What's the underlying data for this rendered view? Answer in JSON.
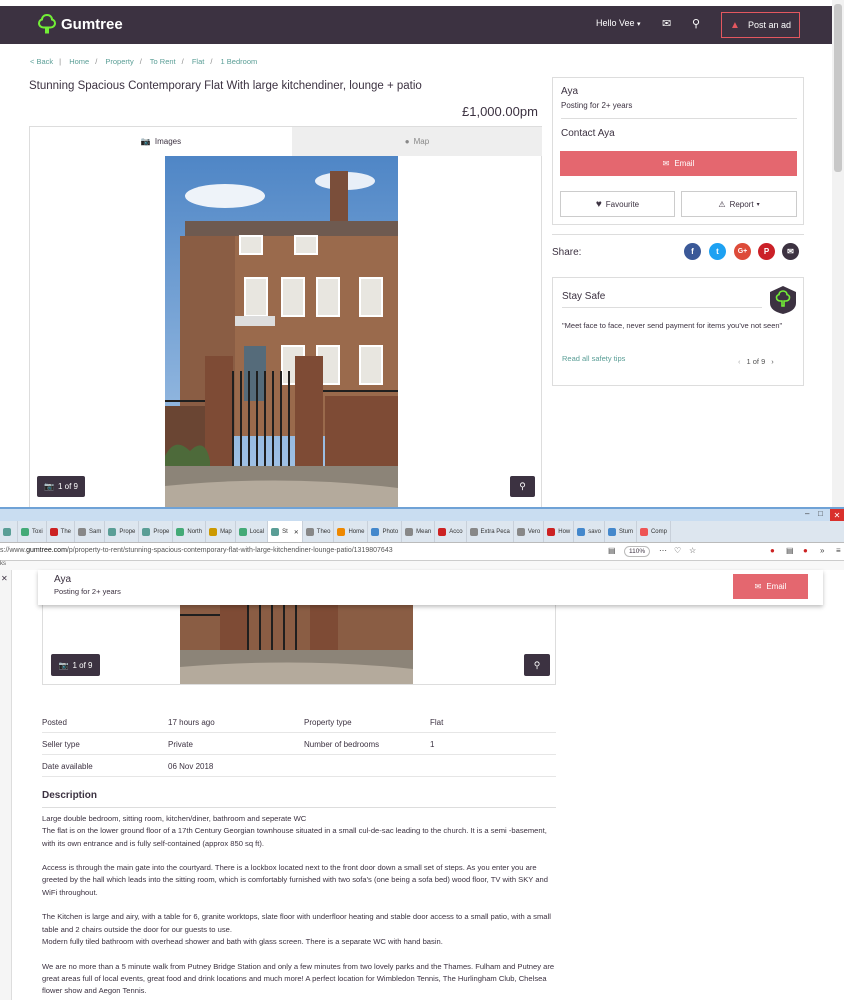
{
  "header": {
    "logo_text": "Gumtree",
    "greeting": "Hello Vee",
    "post_ad_label": "Post an ad"
  },
  "breadcrumb": {
    "back": "< Back",
    "items": [
      "Home",
      "Property",
      "To Rent",
      "Flat",
      "1 Bedroom"
    ]
  },
  "listing": {
    "title": "Stunning Spacious Contemporary Flat With large kitchendiner, lounge + patio",
    "price": "£1,000.00pm",
    "tab_images": "Images",
    "tab_map": "Map",
    "photo_counter": "1 of 9"
  },
  "seller": {
    "name": "Aya",
    "posting_for": "Posting for 2+ years",
    "contact_label": "Contact Aya",
    "email_label": "Email",
    "favourite_label": "Favourite",
    "report_label": "Report"
  },
  "share": {
    "label": "Share:",
    "networks": [
      {
        "name": "facebook-icon",
        "glyph": "f",
        "color": "#3b5998"
      },
      {
        "name": "twitter-icon",
        "glyph": "t",
        "color": "#1da1f2"
      },
      {
        "name": "google-plus-icon",
        "glyph": "G+",
        "color": "#dd4b39"
      },
      {
        "name": "pinterest-icon",
        "glyph": "P",
        "color": "#cb2027"
      },
      {
        "name": "email-share-icon",
        "glyph": "✉",
        "color": "#3c3241"
      }
    ]
  },
  "safety": {
    "title": "Stay Safe",
    "quote": "\"Meet face to face, never send payment for items you've not seen\"",
    "link": "Read all safety tips",
    "pagination": "1 of 9"
  },
  "browser": {
    "url_prefix": "s://www.",
    "url_domain": "gumtree.com",
    "url_path": "/p/property-to-rent/stunning-spacious-contemporary-flat-with-large-kitchendiner-lounge-patio/1319807643",
    "zoom": "110%",
    "bookmarks_label": "ks",
    "tabs": [
      {
        "label": "",
        "color": "#5a9e96"
      },
      {
        "label": "Toxi",
        "color": "#4a7"
      },
      {
        "label": "The",
        "color": "#c22"
      },
      {
        "label": "Sam",
        "color": "#888"
      },
      {
        "label": "Prope",
        "color": "#5a9e96"
      },
      {
        "label": "Prope",
        "color": "#5a9e96"
      },
      {
        "label": "North",
        "color": "#4a7"
      },
      {
        "label": "Map",
        "color": "#c90"
      },
      {
        "label": "Local",
        "color": "#4a7"
      },
      {
        "label": "St",
        "color": "#5a9e96"
      },
      {
        "label": "Theo",
        "color": "#888"
      },
      {
        "label": "Home",
        "color": "#e80"
      },
      {
        "label": "Photo",
        "color": "#48c"
      },
      {
        "label": "Mean",
        "color": "#888"
      },
      {
        "label": "Acco",
        "color": "#c22"
      },
      {
        "label": "Extra Peca",
        "color": "#888"
      },
      {
        "label": "Vero",
        "color": "#888"
      },
      {
        "label": "How",
        "color": "#c22"
      },
      {
        "label": "savo",
        "color": "#48c"
      },
      {
        "label": "Stum",
        "color": "#48c"
      },
      {
        "label": "Comp",
        "color": "#e55"
      }
    ]
  },
  "details": {
    "rows": [
      {
        "l1": "Posted",
        "v1": "17 hours ago",
        "l2": "Property type",
        "v2": "Flat"
      },
      {
        "l1": "Seller type",
        "v1": "Private",
        "l2": "Number of bedrooms",
        "v2": "1"
      },
      {
        "l1": "Date available",
        "v1": "06 Nov 2018",
        "l2": "",
        "v2": ""
      }
    ]
  },
  "description": {
    "heading": "Description",
    "paragraphs": [
      "Large double bedroom, sitting room, kitchen/diner, bathroom and seperate WC\nThe flat is on the lower ground floor of a 17th Century Georgian townhouse situated in a small cul-de-sac leading to the church. It is a semi -basement, with its own entrance and is fully self-contained (approx 850 sq ft).",
      "Access is through the main gate into the courtyard. There is a lockbox located next to the front door down a small set of steps. As you enter you are greeted by the hall which leads into the sitting room, which is comfortably furnished with two sofa's (one being a sofa bed) wood floor, TV with SKY and WiFi throughout.",
      "The Kitchen is large and airy, with a table for 6, granite worktops, slate floor with underfloor heating and stable door access to a small patio, with a small table and 2 chairs outside the door for our guests to use.\nModern fully tiled bathroom with overhead shower and bath with glass screen. There is a separate WC with hand basin.",
      "We are no more than a 5 minute walk from Putney Bridge Station and only a few minutes from two lovely parks and the Thames. Fulham and Putney are great areas full of local events, great food and drink locations and much more! A perfect location for Wimbledon Tennis, The Hurlingham Club, Chelsea flower show and Aegon Tennis."
    ]
  }
}
